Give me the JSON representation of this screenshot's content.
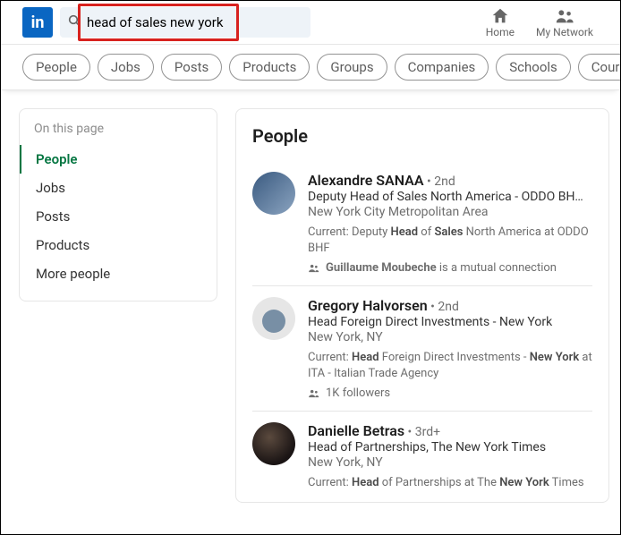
{
  "search": {
    "value": "head of sales new york"
  },
  "nav": {
    "home": "Home",
    "network": "My Network"
  },
  "pills": [
    "People",
    "Jobs",
    "Posts",
    "Products",
    "Groups",
    "Companies",
    "Schools",
    "Cour"
  ],
  "sidebar": {
    "title": "On this page",
    "items": [
      "People",
      "Jobs",
      "Posts",
      "Products",
      "More people"
    ]
  },
  "main": {
    "title": "People",
    "results": [
      {
        "name": "Alexandre SANAA",
        "degree_sep": " • ",
        "degree": "2nd",
        "headline_u": "Deputy Head of Sales",
        "headline_rest": " North America - ODDO BH…",
        "location": "New York City Metropolitan Area",
        "current_pre": "Current: Deputy ",
        "current_b1": "Head",
        "current_mid": " of ",
        "current_b2": "Sales",
        "current_post": " North America at ODDO BHF",
        "meta_b": "Guillaume Moubeche",
        "meta_rest": " is a mutual connection"
      },
      {
        "name": "Gregory Halvorsen",
        "degree_sep": " • ",
        "degree": "2nd",
        "headline": "Head Foreign Direct Investments - New York",
        "location": "New York, NY",
        "current_pre": "Current: ",
        "current_b1": "Head",
        "current_mid": " Foreign Direct Investments - ",
        "current_b2": "New York",
        "current_post": " at ITA - Italian Trade Agency",
        "meta": "1K followers"
      },
      {
        "name": "Danielle Betras",
        "degree_sep": " • ",
        "degree": "3rd+",
        "headline": "Head of Partnerships, The New York Times",
        "location": "New York, NY",
        "current_pre": "Current: ",
        "current_b1": "Head",
        "current_mid": " of Partnerships at The ",
        "current_b2": "New York",
        "current_post": " Times"
      }
    ]
  }
}
